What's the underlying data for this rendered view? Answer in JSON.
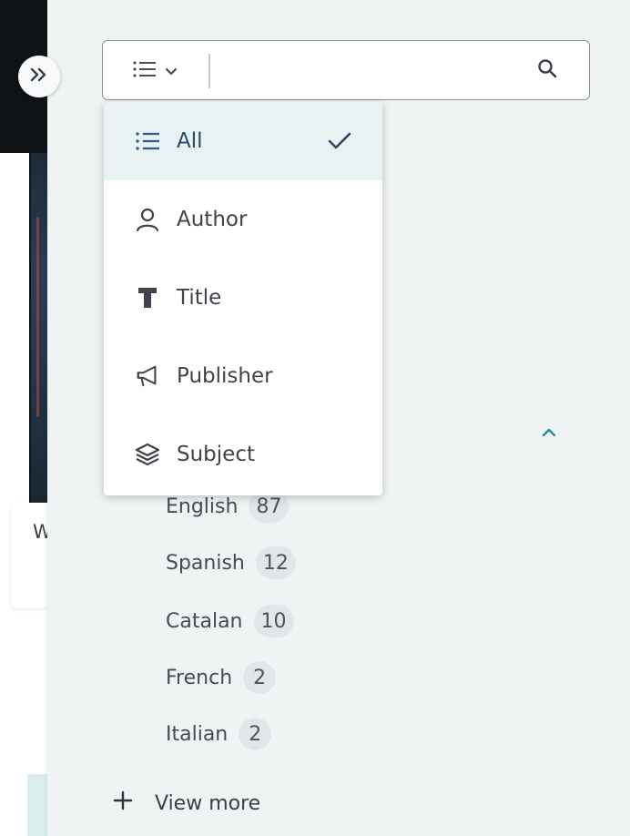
{
  "background": {
    "card_text": "W"
  },
  "search": {
    "placeholder": "",
    "value": ""
  },
  "scope_menu": {
    "items": [
      {
        "label": "All",
        "icon": "list-icon",
        "selected": true
      },
      {
        "label": "Author",
        "icon": "person-icon",
        "selected": false
      },
      {
        "label": "Title",
        "icon": "title-t-icon",
        "selected": false
      },
      {
        "label": "Publisher",
        "icon": "megaphone-icon",
        "selected": false
      },
      {
        "label": "Subject",
        "icon": "layers-icon",
        "selected": false
      }
    ]
  },
  "language_facet": {
    "items": [
      {
        "label": "English",
        "count": "87"
      },
      {
        "label": "Spanish",
        "count": "12"
      },
      {
        "label": "Catalan",
        "count": "10"
      },
      {
        "label": "French",
        "count": "2"
      },
      {
        "label": "Italian",
        "count": "2"
      }
    ],
    "view_more_label": "View more"
  },
  "colors": {
    "accent": "#2c5f8a",
    "chevron": "#2a8c94",
    "selected_bg": "#eaf1f3",
    "sidebar_bg": "#f0f3f4"
  }
}
